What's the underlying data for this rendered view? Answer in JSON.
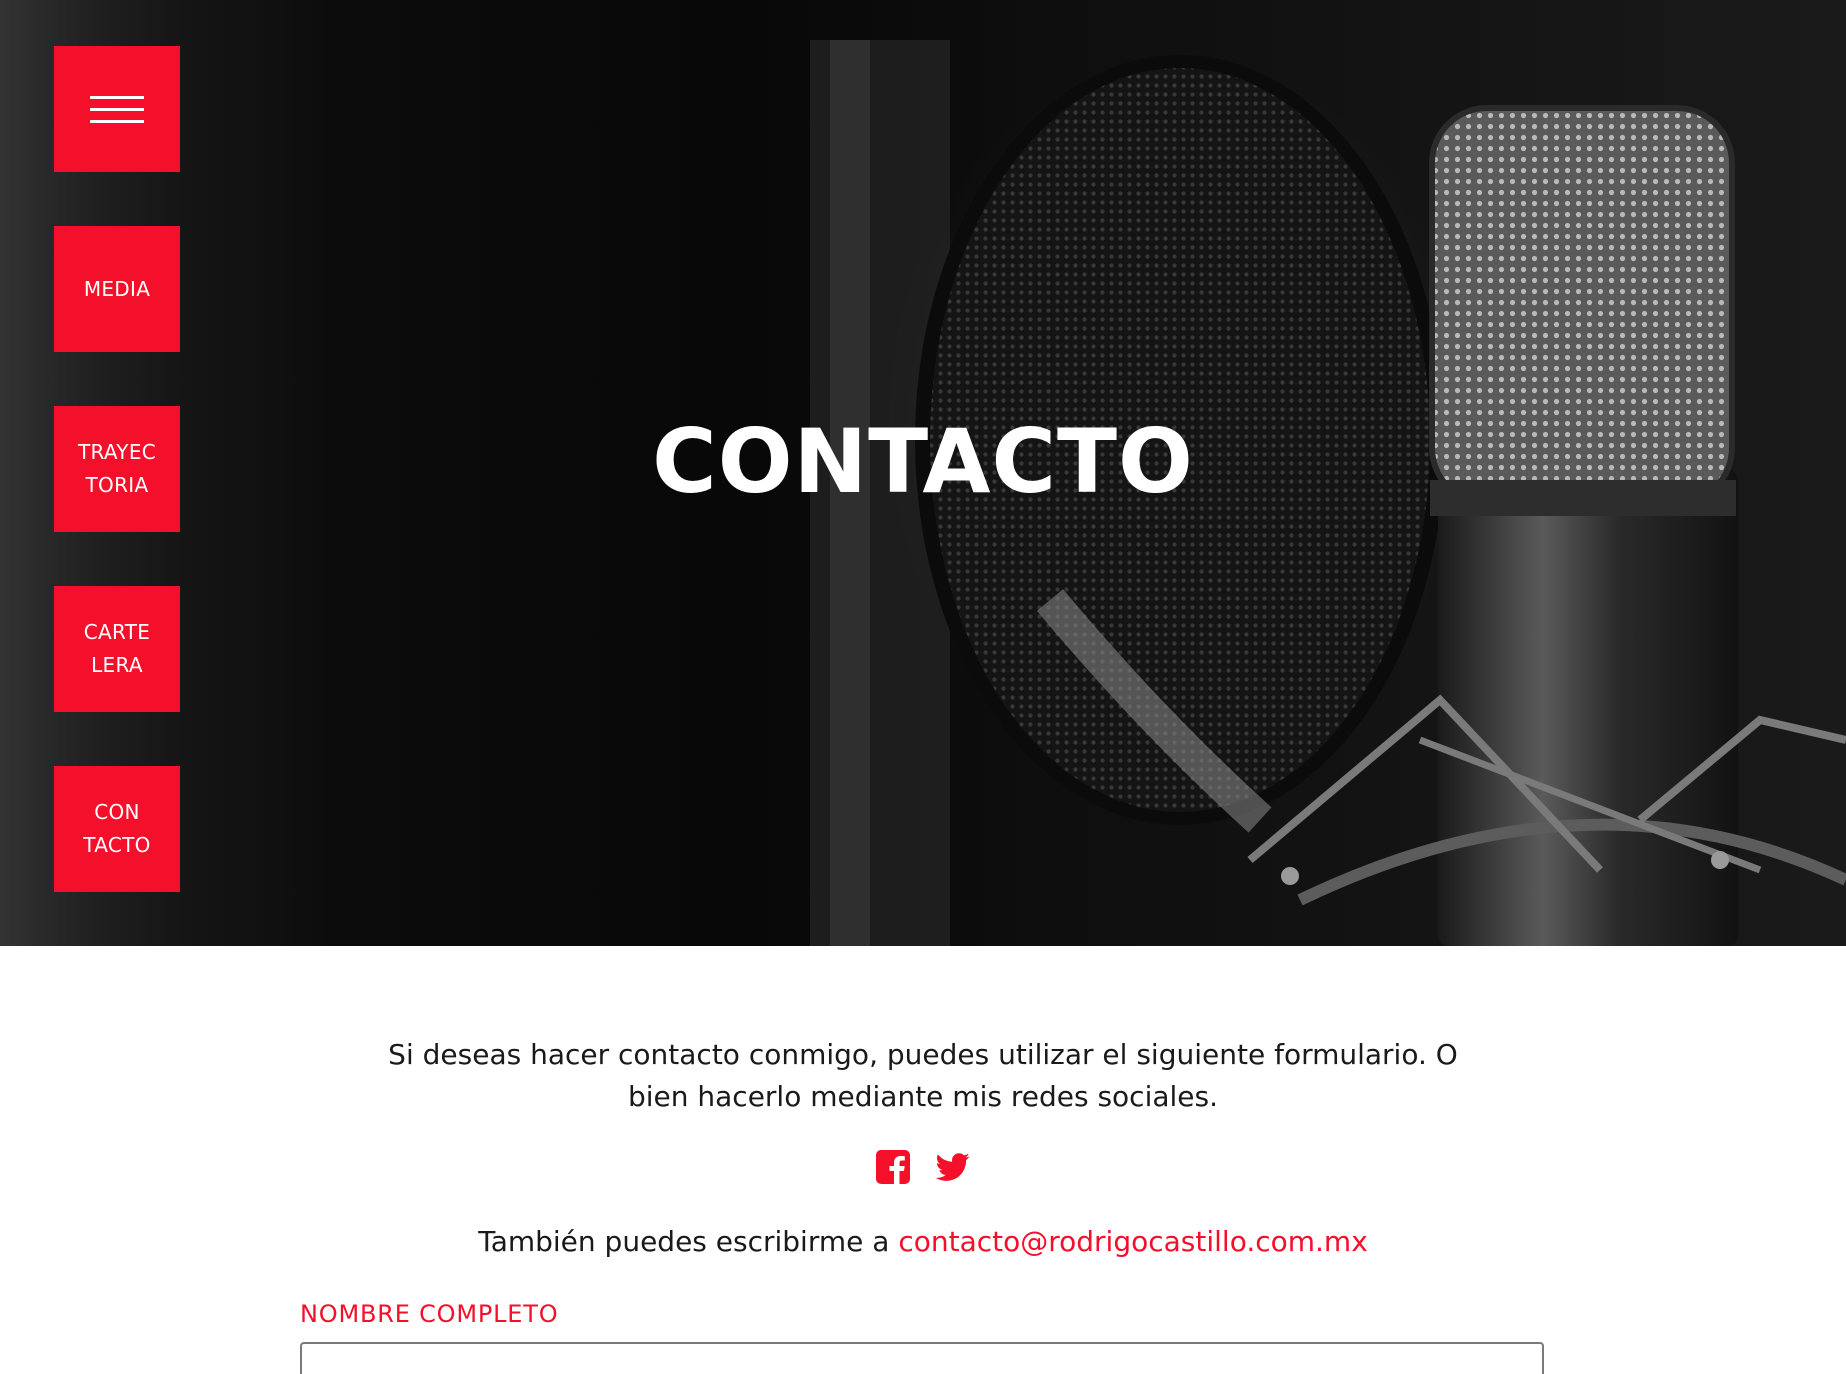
{
  "hero": {
    "title": "CONTACTO"
  },
  "nav": {
    "menu_icon": "hamburger-menu-icon",
    "items": [
      {
        "label": "MEDIA"
      },
      {
        "label": "TRAYEC\nTORIA"
      },
      {
        "label": "CARTE\nLERA"
      },
      {
        "label": "CON\nTACTO"
      }
    ]
  },
  "contact": {
    "intro": "Si deseas hacer contacto conmigo, puedes utilizar el siguiente formulario. O bien hacerlo mediante mis redes sociales.",
    "social_icons": [
      "facebook-icon",
      "twitter-icon"
    ],
    "email_prefix": "También puedes escribirme a ",
    "email": "contacto@rodrigocastillo.com.mx",
    "form": {
      "name_label": "NOMBRE COMPLETO",
      "name_value": ""
    }
  },
  "colors": {
    "accent": "#f40f2a",
    "hero_bg": "#0c0c0c",
    "text": "#1a1a1a"
  }
}
